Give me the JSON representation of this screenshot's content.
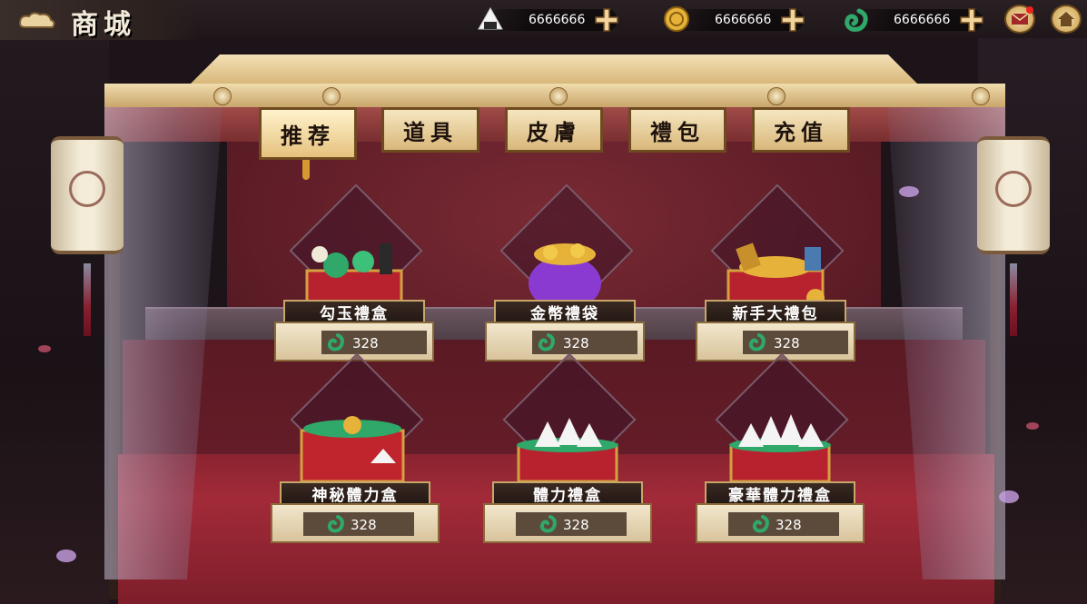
{
  "header": {
    "title": "商城",
    "currencies": [
      {
        "name": "onigiri",
        "icon": "onigiri-icon",
        "amount": "6666666"
      },
      {
        "name": "gold-coin",
        "icon": "gold-coin-icon",
        "amount": "6666666"
      },
      {
        "name": "jade",
        "icon": "jade-magatama-icon",
        "amount": "6666666"
      }
    ],
    "buttons": [
      "mail-icon",
      "home-icon"
    ]
  },
  "tabs": [
    {
      "label": "推荐",
      "active": true
    },
    {
      "label": "道具",
      "active": false
    },
    {
      "label": "皮膚",
      "active": false
    },
    {
      "label": "禮包",
      "active": false
    },
    {
      "label": "充值",
      "active": false
    }
  ],
  "items": [
    {
      "name": "勾玉禮盒",
      "price": "328",
      "art": "jade-gift-box"
    },
    {
      "name": "金幣禮袋",
      "price": "328",
      "art": "gold-coin-bag"
    },
    {
      "name": "新手大禮包",
      "price": "328",
      "art": "newbie-gift-chest"
    },
    {
      "name": "神秘體力盒",
      "price": "328",
      "art": "mystery-stamina-box"
    },
    {
      "name": "體力禮盒",
      "price": "328",
      "art": "stamina-gift-box"
    },
    {
      "name": "豪華體力禮盒",
      "price": "328",
      "art": "deluxe-stamina-gift-box"
    }
  ],
  "colors": {
    "accent": "#d9b77a",
    "wall": "#6a1e2a",
    "price_icon": "#2fa86a"
  }
}
